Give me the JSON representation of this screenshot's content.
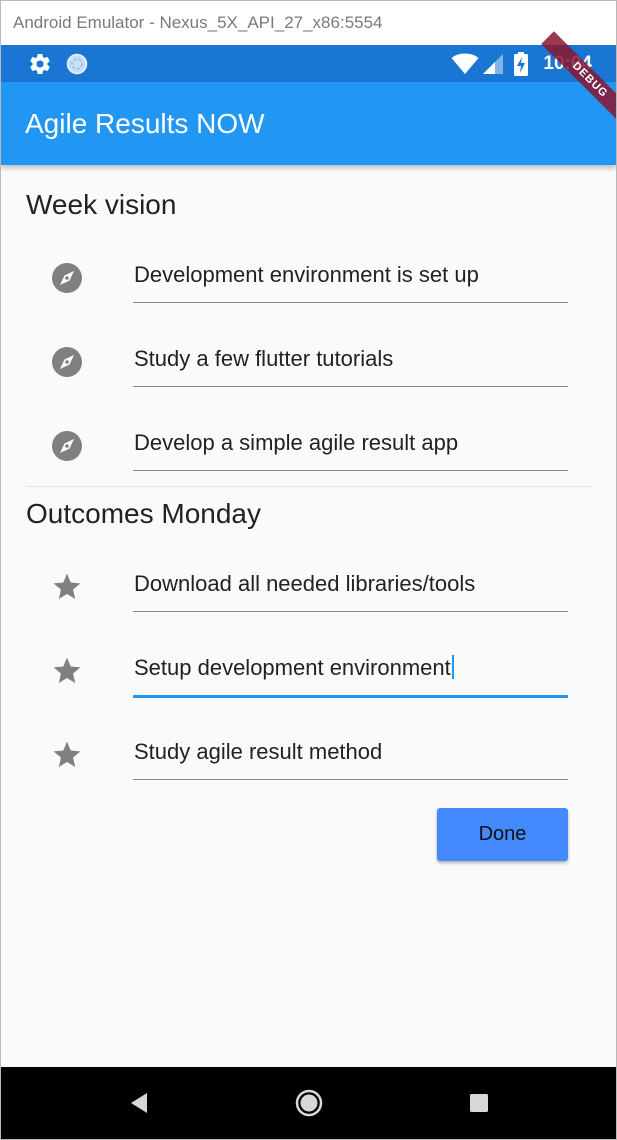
{
  "window": {
    "title": "Android Emulator - Nexus_5X_API_27_x86:5554"
  },
  "status_bar": {
    "time": "10:04",
    "left_icons": [
      "settings-icon",
      "sync-icon"
    ],
    "right_icons": [
      "wifi-icon",
      "signal-icon",
      "battery-icon"
    ],
    "debug_banner": "DEBUG"
  },
  "app_bar": {
    "title": "Agile Results NOW"
  },
  "sections": {
    "week_vision": {
      "title": "Week vision",
      "icon": "compass-icon",
      "items": [
        "Development environment is set up",
        "Study a few flutter tutorials",
        "Develop a simple agile result app"
      ]
    },
    "outcomes": {
      "title": "Outcomes Monday",
      "icon": "star-icon",
      "items": [
        "Download all needed libraries/tools",
        "Setup development environment",
        "Study agile result method"
      ],
      "focused_index": 1
    }
  },
  "actions": {
    "done_label": "Done"
  },
  "nav_bar": {
    "buttons": [
      "back-icon",
      "home-icon",
      "recents-icon"
    ]
  },
  "colors": {
    "status_bar": "#1976d2",
    "app_bar": "#2196f3",
    "button": "#448aff",
    "icon_grey": "#808080",
    "background": "#fafafa"
  }
}
